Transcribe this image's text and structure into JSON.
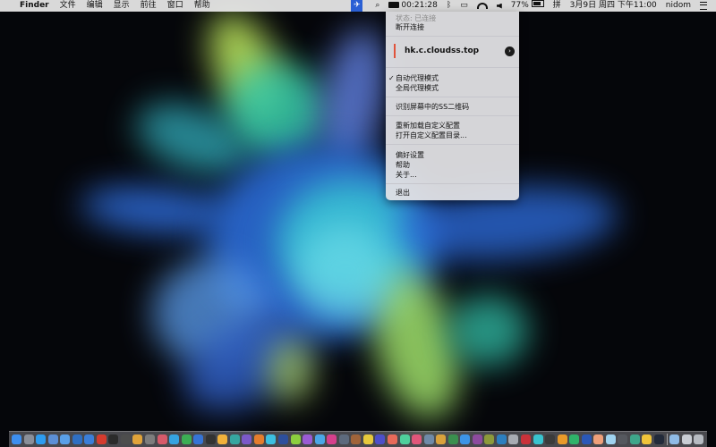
{
  "menubar": {
    "apple_glyph": "",
    "app_name": "Finder",
    "menus": [
      "文件",
      "编辑",
      "显示",
      "前往",
      "窗口",
      "帮助"
    ],
    "status": {
      "shadowsocks_icon": "shadowsocks-paper-plane-icon",
      "search_icon": "spotlight-search-icon",
      "timer": "00:21:28",
      "bluetooth_icon": "bluetooth-icon",
      "airplay_icon": "airplay-icon",
      "wifi_icon": "wifi-icon",
      "volume_icon": "volume-icon",
      "battery_percent": "77%",
      "battery_level": 0.77,
      "input_icon": "input-source-icon",
      "date_time": "3月9日 周四 下午11:00",
      "user": "nidom",
      "notification_icon": "notification-center-icon"
    }
  },
  "menu": {
    "status_label": "状态: 已连接",
    "disconnect": "断开连接",
    "server": "hk.c.cloudss.top",
    "server_indicator_color": "#e0533b",
    "auto_proxy": "自动代理模式",
    "auto_proxy_checked": "✓",
    "global_proxy": "全局代理模式",
    "scan_qr": "识别屏幕中的SS二维码",
    "reload_config": "重新加载自定义配置",
    "open_config_dir": "打开自定义配置目录...",
    "preferences": "偏好设置",
    "help": "帮助",
    "about": "关于...",
    "quit": "退出"
  },
  "dock": {
    "left_icons": [
      {
        "name": "finder-icon",
        "color": "#3d8ff0"
      },
      {
        "name": "launchpad-icon",
        "color": "#8a8f99"
      },
      {
        "name": "safari-icon",
        "color": "#2d9cf0"
      },
      {
        "name": "preview-icon",
        "color": "#5c8fd6"
      },
      {
        "name": "folder-icon",
        "color": "#5aa0e8"
      },
      {
        "name": "xcode-icon",
        "color": "#2f6fc2"
      },
      {
        "name": "mail-icon",
        "color": "#3b7ed8"
      },
      {
        "name": "app-red-icon",
        "color": "#d53b2e"
      },
      {
        "name": "terminal-icon",
        "color": "#2b2b2b"
      },
      {
        "name": "app-m-icon",
        "color": "#4d4d4d"
      },
      {
        "name": "chrome-icon",
        "color": "#e0a33a"
      },
      {
        "name": "app-gray-icon",
        "color": "#7d7d7d"
      },
      {
        "name": "app-pink-icon",
        "color": "#d75a6a"
      },
      {
        "name": "telegram-icon",
        "color": "#35a3e0"
      },
      {
        "name": "app-green-icon",
        "color": "#3cae54"
      },
      {
        "name": "app-blue-icon",
        "color": "#3674d6"
      },
      {
        "name": "app-dark-icon",
        "color": "#333333"
      },
      {
        "name": "sketch-icon",
        "color": "#f2b23b"
      },
      {
        "name": "app-teal-icon",
        "color": "#36a6a0"
      },
      {
        "name": "app-purple-icon",
        "color": "#7b59c9"
      },
      {
        "name": "app-orange-icon",
        "color": "#e57d2d"
      },
      {
        "name": "app-cyan-icon",
        "color": "#3cbfe0"
      },
      {
        "name": "app-navy-icon",
        "color": "#2d4f9c"
      },
      {
        "name": "app-lime-icon",
        "color": "#8ccf3e"
      },
      {
        "name": "app-violet-icon",
        "color": "#9a5bd4"
      },
      {
        "name": "app-sky-icon",
        "color": "#4aa7e6"
      },
      {
        "name": "app-magenta-icon",
        "color": "#d6408c"
      },
      {
        "name": "app-slate-icon",
        "color": "#5d6a7d"
      },
      {
        "name": "app-brown-icon",
        "color": "#a0643a"
      },
      {
        "name": "app-yellow-icon",
        "color": "#e6c93c"
      },
      {
        "name": "app-indigo-icon",
        "color": "#4d4fc9"
      },
      {
        "name": "app-coral-icon",
        "color": "#e86a5a"
      },
      {
        "name": "app-mint-icon",
        "color": "#4fcf9c"
      },
      {
        "name": "app-rose-icon",
        "color": "#e0567a"
      },
      {
        "name": "app-steel-icon",
        "color": "#6f8aa8"
      },
      {
        "name": "app-gold-icon",
        "color": "#d9a23c"
      },
      {
        "name": "app-forest-icon",
        "color": "#3a8f4e"
      },
      {
        "name": "app-azure-icon",
        "color": "#3d94e6"
      },
      {
        "name": "app-plum-icon",
        "color": "#8d4b9e"
      },
      {
        "name": "app-olive-icon",
        "color": "#8c9a3a"
      },
      {
        "name": "app-ocean-icon",
        "color": "#2c7fbf"
      },
      {
        "name": "app-silver-icon",
        "color": "#a8acb3"
      },
      {
        "name": "app-crimson-icon",
        "color": "#c9323a"
      },
      {
        "name": "app-aqua-icon",
        "color": "#39c4cf"
      },
      {
        "name": "app-charcoal-icon",
        "color": "#3b3b3b"
      },
      {
        "name": "app-amber-icon",
        "color": "#e99a2a"
      },
      {
        "name": "app-emerald-icon",
        "color": "#2fb36a"
      },
      {
        "name": "app-cobalt-icon",
        "color": "#2a58b8"
      },
      {
        "name": "app-peach-icon",
        "color": "#efa07a"
      },
      {
        "name": "app-ice-icon",
        "color": "#9fd3ef"
      },
      {
        "name": "app-graphite-icon",
        "color": "#55585e"
      },
      {
        "name": "app-jade-icon",
        "color": "#3ea68a"
      },
      {
        "name": "app-sun-icon",
        "color": "#f0c43a"
      },
      {
        "name": "app-ink-icon",
        "color": "#222a3a"
      }
    ],
    "right_icons": [
      {
        "name": "downloads-stack-icon",
        "color": "#8fbbe6"
      },
      {
        "name": "documents-stack-icon",
        "color": "#c9cdd4"
      },
      {
        "name": "trash-icon",
        "color": "#b7bbc2"
      }
    ]
  }
}
